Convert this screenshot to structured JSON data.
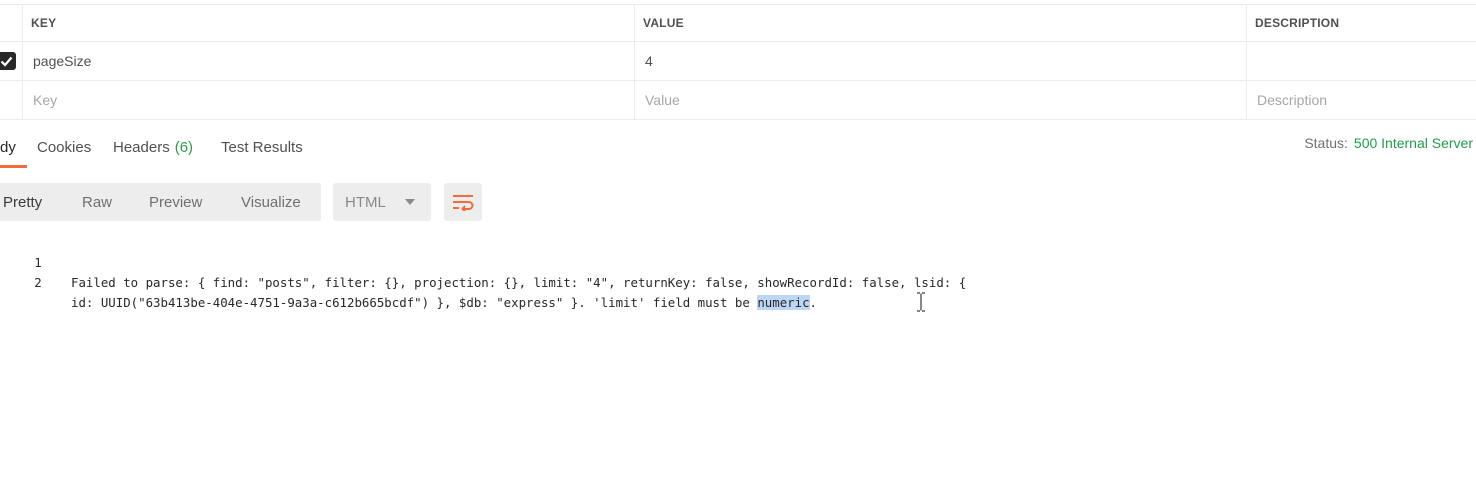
{
  "params": {
    "headers": {
      "key": "KEY",
      "value": "VALUE",
      "description": "DESCRIPTION"
    },
    "rows": [
      {
        "checked": true,
        "key": "pageSize",
        "value": "4",
        "description": ""
      }
    ],
    "new_row": {
      "key_placeholder": "Key",
      "value_placeholder": "Value",
      "description_placeholder": "Description"
    }
  },
  "response_tabs": {
    "body": "dy",
    "cookies": "Cookies",
    "headers_label": "Headers",
    "headers_count": "(6)",
    "test_results": "Test Results"
  },
  "status": {
    "label": "Status:",
    "value": "500 Internal Server"
  },
  "view": {
    "pretty": "Pretty",
    "raw": "Raw",
    "preview": "Preview",
    "visualize": "Visualize",
    "format": "HTML"
  },
  "body": {
    "lines": [
      {
        "no": "1",
        "text": "Failed to parse: { find: \"posts\", filter: {}, projection: {}, limit: \"4\", returnKey: false, showRecordId: false, lsid: {"
      },
      {
        "no": "2",
        "text_before": "id: UUID(\"63b413be-404e-4751-9a3a-c612b665bcdf\") }, $db: \"express\" }. 'limit' field must be ",
        "selected": "numeric",
        "text_after": "."
      }
    ]
  },
  "colors": {
    "accent": "#f26b3a",
    "status_ok": "#1f9e4a",
    "count": "#2e9a48",
    "selection": "#bcd6f5"
  },
  "icons": {
    "checkbox": "checkmark-icon",
    "wrap": "wrap-lines-icon",
    "caret": "chevron-down-icon",
    "cursor": "text-cursor-icon"
  }
}
